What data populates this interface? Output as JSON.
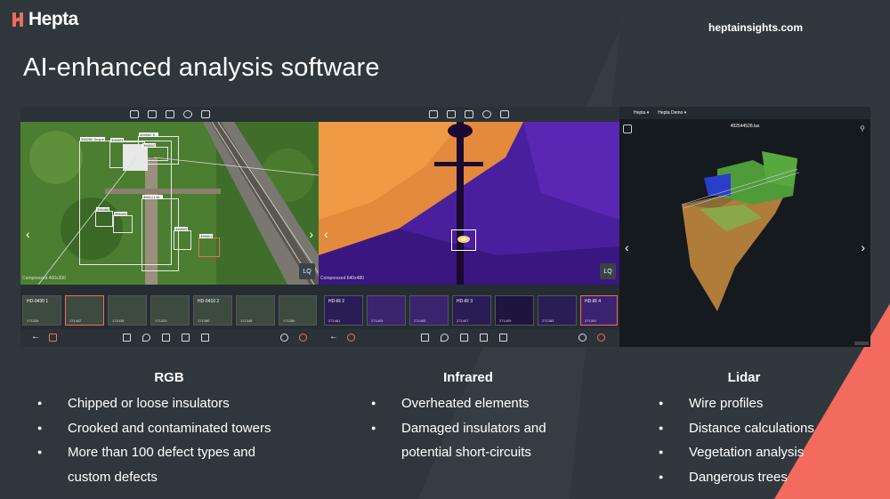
{
  "brand": {
    "name": "Hepta",
    "website": "heptainsights.com",
    "accent": "#f26b5e"
  },
  "headline": "AI-enhanced analysis software",
  "panels": {
    "rgb": {
      "caption": "Compressed 400x300",
      "quality": "LQ",
      "detections": [
        "396280 Suspe",
        "396503",
        "405952 S...",
        "396502",
        "396488",
        "396499",
        "396121 W...",
        "396500",
        "396501"
      ],
      "thumbs": [
        {
          "label": "HD-0430 1",
          "num": "171334"
        },
        {
          "label": "",
          "num": "171402"
        },
        {
          "label": "",
          "num": "171035"
        },
        {
          "label": "",
          "num": "171323"
        },
        {
          "label": "HD-0410 2",
          "num": "171080"
        },
        {
          "label": "",
          "num": "171348"
        },
        {
          "label": "",
          "num": "171350"
        }
      ]
    },
    "infrared": {
      "caption": "Compressed 640x480",
      "quality": "LQ",
      "thumbs": [
        {
          "label": "HD-IR 2",
          "num": "271461"
        },
        {
          "label": "",
          "num": "271403"
        },
        {
          "label": "",
          "num": "271405"
        },
        {
          "label": "HD-IR 3",
          "num": "271407"
        },
        {
          "label": "",
          "num": "271409"
        },
        {
          "label": "",
          "num": "271383"
        },
        {
          "label": "HD-IR 4",
          "num": "271391"
        }
      ]
    },
    "lidar": {
      "menu": [
        "Hepta ▾",
        "Hepta Demo ▾"
      ],
      "file": "492544528.las"
    }
  },
  "columns": [
    {
      "title": "RGB",
      "items": [
        {
          "text": "Chipped or loose insulators",
          "bullet": true
        },
        {
          "text": "Crooked and contaminated towers",
          "bullet": true
        },
        {
          "text": "More than 100 defect types and",
          "bullet": true
        },
        {
          "text": "custom defects",
          "bullet": false
        }
      ]
    },
    {
      "title": "Infrared",
      "items": [
        {
          "text": "Overheated elements",
          "bullet": true
        },
        {
          "text": "Damaged insulators and",
          "bullet": true
        },
        {
          "text": "potential short-circuits",
          "bullet": false
        }
      ]
    },
    {
      "title": "Lidar",
      "items": [
        {
          "text": "Wire profiles",
          "bullet": true
        },
        {
          "text": "Distance calculations",
          "bullet": true
        },
        {
          "text": "Vegetation analysis",
          "bullet": true
        },
        {
          "text": "Dangerous trees",
          "bullet": true
        }
      ]
    }
  ]
}
